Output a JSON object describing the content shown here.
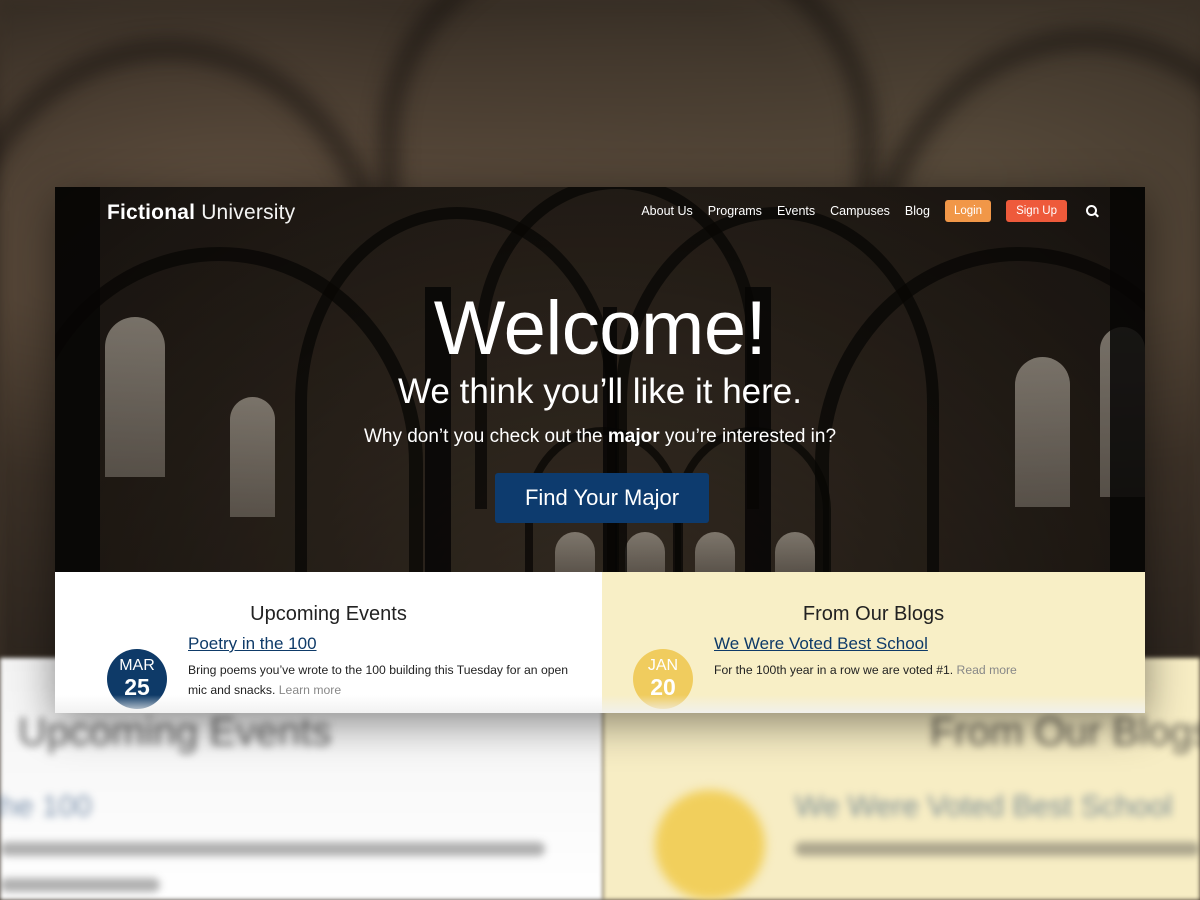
{
  "header": {
    "logo_bold": "Fictional",
    "logo_light": "University",
    "nav": [
      "About Us",
      "Programs",
      "Events",
      "Campuses",
      "Blog"
    ],
    "login_label": "Login",
    "signup_label": "Sign Up",
    "search_icon": "search-icon"
  },
  "hero": {
    "title": "Welcome!",
    "subtitle": "We think you’ll like it here.",
    "line_before": "Why don’t you check out the ",
    "line_bold": "major",
    "line_after": " you’re interested in?",
    "cta_label": "Find Your Major"
  },
  "events": {
    "heading": "Upcoming Events",
    "items": [
      {
        "month": "MAR",
        "day": "25",
        "title": "Poetry in the 100",
        "text": "Bring poems you’ve wrote to the 100 building this Tuesday for an open mic and snacks.",
        "link": "Learn more"
      }
    ]
  },
  "blogs": {
    "heading": "From Our Blogs",
    "items": [
      {
        "month": "JAN",
        "day": "20",
        "title": "We Were Voted Best School",
        "text": "For the 100th year in a row we are voted #1.",
        "link": "Read more"
      }
    ]
  },
  "colors": {
    "primary_blue": "#0d3b6e",
    "login_orange": "#f19748",
    "signup_red": "#ee5a3b",
    "badge_yellow": "#f0cc5e",
    "blog_bg": "#f8efc6"
  }
}
